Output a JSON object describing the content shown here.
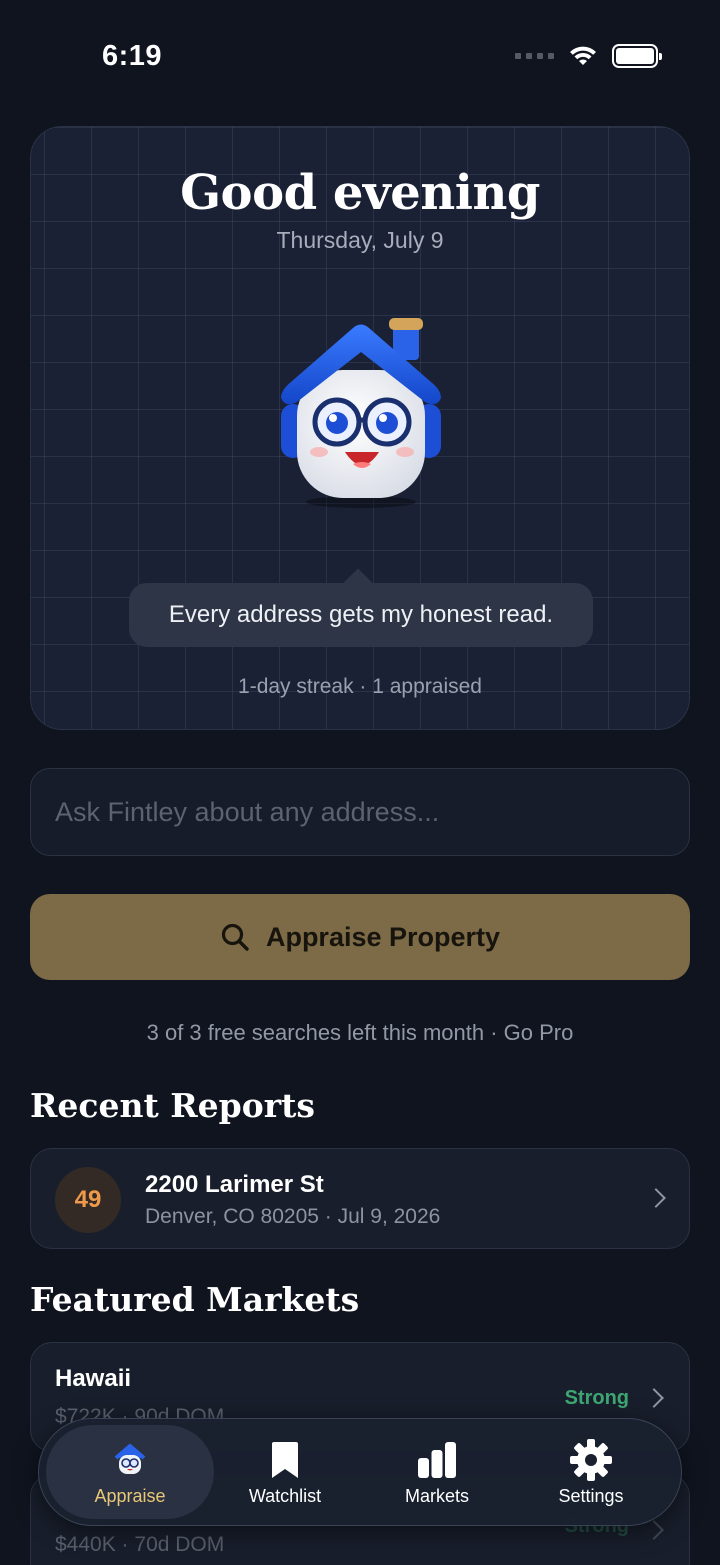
{
  "status_bar": {
    "time": "6:19"
  },
  "hero": {
    "greeting": "Good evening",
    "date": "Thursday, July 9",
    "speech": "Every address gets my honest read.",
    "streak": "1-day streak · 1 appraised"
  },
  "ask": {
    "placeholder": "Ask Fintley about any address..."
  },
  "appraise_button": {
    "label": "Appraise Property"
  },
  "free_note": "3 of 3 free searches left this month · Go Pro",
  "recent": {
    "title": "Recent Reports",
    "items": [
      {
        "score": "49",
        "address": "2200 Larimer St",
        "sub": "Denver, CO 80205 · Jul 9, 2026"
      }
    ]
  },
  "featured": {
    "title": "Featured Markets",
    "items": [
      {
        "name": "Hawaii",
        "sub": "$722K  ·  90d DOM",
        "status": "Strong"
      },
      {
        "name": "",
        "sub": "$440K  ·  70d DOM",
        "status": "Strong"
      }
    ]
  },
  "tabs": [
    {
      "label": "Appraise",
      "icon": "mascot-icon",
      "active": true
    },
    {
      "label": "Watchlist",
      "icon": "bookmark-icon"
    },
    {
      "label": "Markets",
      "icon": "bar-chart-icon"
    },
    {
      "label": "Settings",
      "icon": "gear-icon"
    }
  ],
  "colors": {
    "background": "#0f141f",
    "accent_gold": "#e8c877",
    "button_gold": "#7d6a46",
    "score_orange": "#ef9a4a",
    "strong_green": "#3fa673"
  }
}
